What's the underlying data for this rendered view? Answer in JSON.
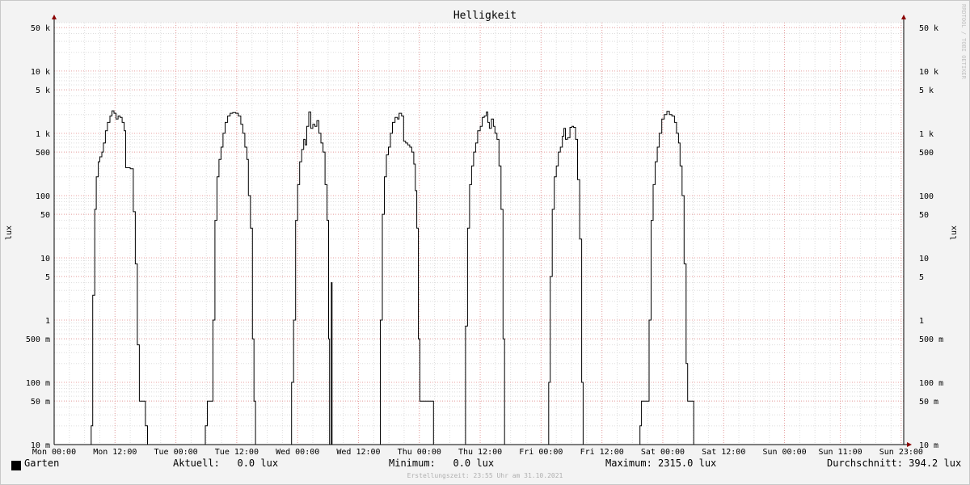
{
  "chart_data": {
    "type": "line",
    "title": "Helligkeit",
    "ylabel": "lux",
    "ylabel_right": "lux",
    "yscale": "log",
    "ylim": [
      0.01,
      60000
    ],
    "y_ticks": [
      {
        "value": 50000,
        "label": "50 k"
      },
      {
        "value": 10000,
        "label": "10 k"
      },
      {
        "value": 5000,
        "label": "5 k"
      },
      {
        "value": 1000,
        "label": "1 k"
      },
      {
        "value": 500,
        "label": "500"
      },
      {
        "value": 100,
        "label": "100"
      },
      {
        "value": 50,
        "label": "50"
      },
      {
        "value": 10,
        "label": "10"
      },
      {
        "value": 5,
        "label": "5"
      },
      {
        "value": 1,
        "label": "1"
      },
      {
        "value": 0.5,
        "label": "500 m"
      },
      {
        "value": 0.1,
        "label": "100 m"
      },
      {
        "value": 0.05,
        "label": "50 m"
      },
      {
        "value": 0.01,
        "label": "10 m"
      }
    ],
    "xlim": [
      0,
      167.5
    ],
    "x_ticks": [
      {
        "value": 0,
        "label": "Mon 00:00"
      },
      {
        "value": 12,
        "label": "Mon 12:00"
      },
      {
        "value": 24,
        "label": "Tue 00:00"
      },
      {
        "value": 36,
        "label": "Tue 12:00"
      },
      {
        "value": 48,
        "label": "Wed 00:00"
      },
      {
        "value": 60,
        "label": "Wed 12:00"
      },
      {
        "value": 72,
        "label": "Thu 00:00"
      },
      {
        "value": 84,
        "label": "Thu 12:00"
      },
      {
        "value": 96,
        "label": "Fri 00:00"
      },
      {
        "value": 108,
        "label": "Fri 12:00"
      },
      {
        "value": 120,
        "label": "Sat 00:00"
      },
      {
        "value": 132,
        "label": "Sat 12:00"
      },
      {
        "value": 144,
        "label": "Sun 00:00"
      },
      {
        "value": 155,
        "label": "Sun 11:00"
      },
      {
        "value": 167,
        "label": "Sun 23:00"
      }
    ],
    "grid": true,
    "series": [
      {
        "name": "Garten",
        "color": "#000000",
        "points": [
          [
            0,
            0.01
          ],
          [
            7.2,
            0.01
          ],
          [
            7.3,
            0.02
          ],
          [
            7.6,
            2.5
          ],
          [
            8.0,
            60
          ],
          [
            8.3,
            200
          ],
          [
            8.7,
            350
          ],
          [
            9.0,
            420
          ],
          [
            9.4,
            500
          ],
          [
            9.7,
            700
          ],
          [
            10.1,
            1100
          ],
          [
            10.5,
            1500
          ],
          [
            11.0,
            1900
          ],
          [
            11.4,
            2300
          ],
          [
            11.8,
            2100
          ],
          [
            12.2,
            1700
          ],
          [
            12.6,
            1900
          ],
          [
            13.0,
            1800
          ],
          [
            13.4,
            1500
          ],
          [
            13.8,
            1100
          ],
          [
            14.1,
            280
          ],
          [
            15.0,
            270
          ],
          [
            15.4,
            270
          ],
          [
            15.6,
            55
          ],
          [
            16.0,
            8
          ],
          [
            16.4,
            0.4
          ],
          [
            16.8,
            0.05
          ],
          [
            17.5,
            0.05
          ],
          [
            18.0,
            0.02
          ],
          [
            18.4,
            0.01
          ],
          [
            29.5,
            0.01
          ],
          [
            29.8,
            0.02
          ],
          [
            30.2,
            0.05
          ],
          [
            31.0,
            0.05
          ],
          [
            31.3,
            1
          ],
          [
            31.7,
            40
          ],
          [
            32.1,
            200
          ],
          [
            32.5,
            380
          ],
          [
            32.9,
            600
          ],
          [
            33.3,
            1000
          ],
          [
            33.7,
            1500
          ],
          [
            34.2,
            1900
          ],
          [
            34.7,
            2100
          ],
          [
            35.2,
            2150
          ],
          [
            35.8,
            2100
          ],
          [
            36.3,
            1900
          ],
          [
            36.8,
            1400
          ],
          [
            37.2,
            1000
          ],
          [
            37.6,
            600
          ],
          [
            38.0,
            380
          ],
          [
            38.3,
            100
          ],
          [
            38.7,
            30
          ],
          [
            39.1,
            0.5
          ],
          [
            39.4,
            0.05
          ],
          [
            39.7,
            0.01
          ],
          [
            46.5,
            0.01
          ],
          [
            46.8,
            0.1
          ],
          [
            47.2,
            1
          ],
          [
            47.6,
            40
          ],
          [
            48.0,
            150
          ],
          [
            48.4,
            350
          ],
          [
            48.8,
            550
          ],
          [
            49.2,
            800
          ],
          [
            49.5,
            650
          ],
          [
            49.8,
            1300
          ],
          [
            50.2,
            2200
          ],
          [
            50.6,
            1200
          ],
          [
            51.0,
            1400
          ],
          [
            51.4,
            1300
          ],
          [
            51.8,
            1600
          ],
          [
            52.2,
            1000
          ],
          [
            52.6,
            700
          ],
          [
            53.0,
            500
          ],
          [
            53.4,
            150
          ],
          [
            53.8,
            40
          ],
          [
            54.1,
            0.5
          ],
          [
            54.3,
            0.01
          ],
          [
            54.6,
            0.01
          ],
          [
            54.65,
            4
          ],
          [
            54.75,
            4
          ],
          [
            54.8,
            0.01
          ],
          [
            64.0,
            0.01
          ],
          [
            64.3,
            1
          ],
          [
            64.7,
            50
          ],
          [
            65.1,
            200
          ],
          [
            65.5,
            450
          ],
          [
            65.9,
            600
          ],
          [
            66.3,
            1000
          ],
          [
            66.7,
            1500
          ],
          [
            67.2,
            1800
          ],
          [
            67.7,
            1700
          ],
          [
            68.0,
            2100
          ],
          [
            68.5,
            1900
          ],
          [
            68.9,
            750
          ],
          [
            69.3,
            700
          ],
          [
            69.7,
            650
          ],
          [
            70.1,
            600
          ],
          [
            70.5,
            500
          ],
          [
            70.9,
            320
          ],
          [
            71.2,
            120
          ],
          [
            71.5,
            30
          ],
          [
            71.8,
            0.5
          ],
          [
            72.1,
            0.05
          ],
          [
            74.6,
            0.05
          ],
          [
            74.8,
            0.01
          ],
          [
            80.8,
            0.01
          ],
          [
            81.1,
            0.8
          ],
          [
            81.5,
            30
          ],
          [
            81.9,
            150
          ],
          [
            82.3,
            300
          ],
          [
            82.7,
            500
          ],
          [
            83.1,
            700
          ],
          [
            83.5,
            1100
          ],
          [
            84.0,
            1300
          ],
          [
            84.4,
            1800
          ],
          [
            84.8,
            1900
          ],
          [
            85.2,
            2200
          ],
          [
            85.5,
            1500
          ],
          [
            85.8,
            1200
          ],
          [
            86.2,
            1700
          ],
          [
            86.6,
            1300
          ],
          [
            86.9,
            1000
          ],
          [
            87.3,
            800
          ],
          [
            87.7,
            300
          ],
          [
            88.1,
            60
          ],
          [
            88.5,
            0.5
          ],
          [
            88.8,
            0.01
          ],
          [
            97.3,
            0.01
          ],
          [
            97.5,
            0.1
          ],
          [
            97.8,
            5
          ],
          [
            98.2,
            60
          ],
          [
            98.6,
            200
          ],
          [
            99.0,
            300
          ],
          [
            99.4,
            500
          ],
          [
            99.8,
            600
          ],
          [
            100.2,
            900
          ],
          [
            100.5,
            1200
          ],
          [
            100.8,
            800
          ],
          [
            101.2,
            850
          ],
          [
            101.7,
            1250
          ],
          [
            102.1,
            1300
          ],
          [
            102.4,
            1250
          ],
          [
            102.8,
            800
          ],
          [
            103.2,
            180
          ],
          [
            103.6,
            20
          ],
          [
            104.0,
            0.1
          ],
          [
            104.3,
            0.01
          ],
          [
            115.2,
            0.01
          ],
          [
            115.5,
            0.02
          ],
          [
            115.8,
            0.05
          ],
          [
            117.0,
            0.05
          ],
          [
            117.3,
            1
          ],
          [
            117.7,
            40
          ],
          [
            118.1,
            150
          ],
          [
            118.5,
            350
          ],
          [
            118.9,
            600
          ],
          [
            119.3,
            1000
          ],
          [
            119.8,
            1700
          ],
          [
            120.3,
            2000
          ],
          [
            120.8,
            2250
          ],
          [
            121.3,
            2000
          ],
          [
            121.8,
            1900
          ],
          [
            122.3,
            1500
          ],
          [
            122.7,
            1000
          ],
          [
            123.1,
            700
          ],
          [
            123.4,
            300
          ],
          [
            123.8,
            100
          ],
          [
            124.2,
            8
          ],
          [
            124.6,
            0.2
          ],
          [
            124.9,
            0.05
          ],
          [
            125.8,
            0.05
          ],
          [
            126.1,
            0.01
          ],
          [
            167.5,
            0.01
          ]
        ]
      }
    ]
  },
  "legend": {
    "series_label": "Garten",
    "aktuell": "Aktuell:   0.0 lux",
    "minimum": "Minimum:   0.0 lux",
    "maximum": "Maximum: 2315.0 lux",
    "durchschnitt": "Durchschnitt: 394.2 lux"
  },
  "footer": "Erstellungszeit: 23:55 Uhr am 31.10.2021",
  "watermark": "RRDTOOL / TOBI OETIKER"
}
